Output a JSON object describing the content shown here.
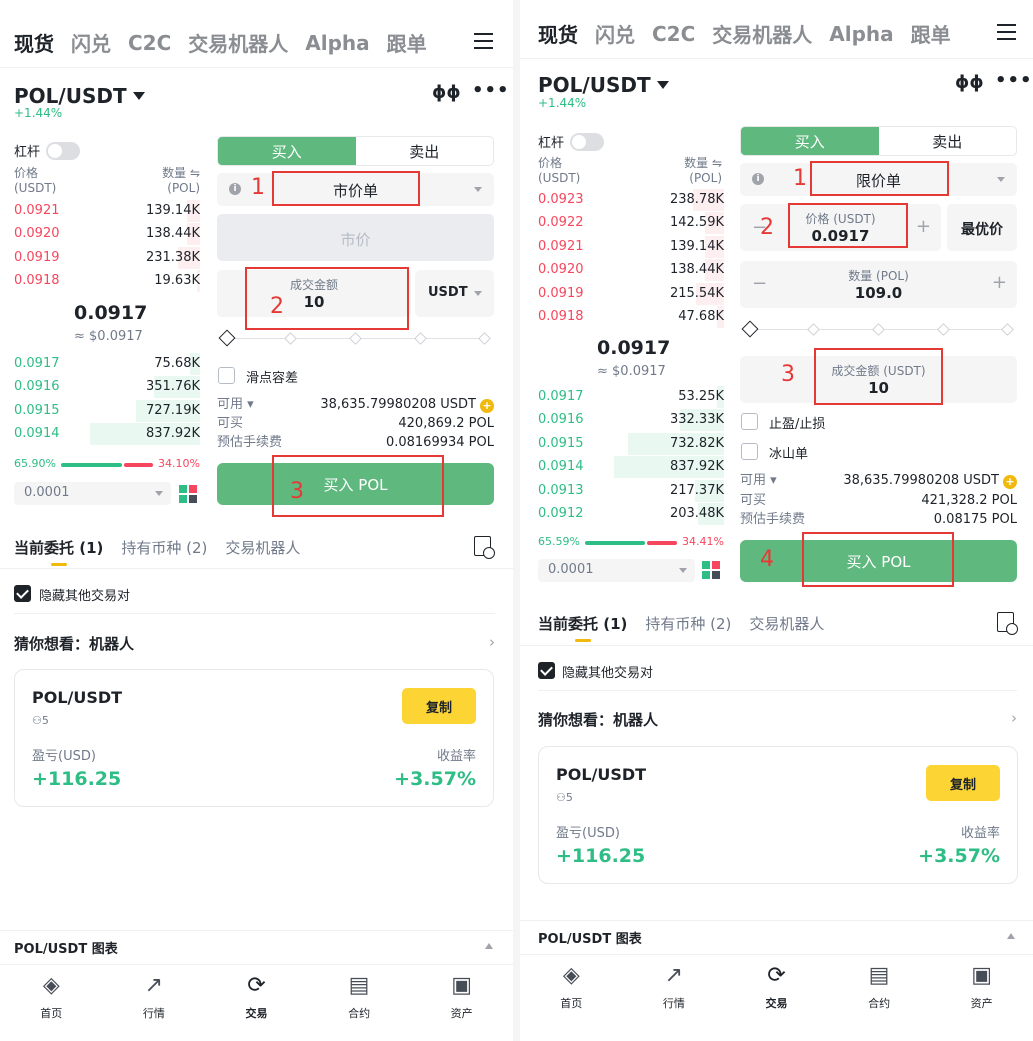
{
  "top_tabs": [
    "现货",
    "闪兑",
    "C2C",
    "交易机器人",
    "Alpha",
    "跟单"
  ],
  "pair": "POL/USDT",
  "change": "+1.44%",
  "leverage_label": "杠杆",
  "price_header": "价格",
  "price_unit": "(USDT)",
  "qty_header": "数量 ⇋",
  "qty_unit": "(POL)",
  "buy_label": "买入",
  "sell_label": "卖出",
  "left": {
    "asks": [
      {
        "price": "0.0921",
        "qty": "139.14K",
        "depth": 0.12
      },
      {
        "price": "0.0920",
        "qty": "138.44K",
        "depth": 0.12
      },
      {
        "price": "0.0919",
        "qty": "231.38K",
        "depth": 0.2
      },
      {
        "price": "0.0918",
        "qty": "19.63K",
        "depth": 0.03
      }
    ],
    "mid_price": "0.0917",
    "mid_usd": "≈ $0.0917",
    "bids": [
      {
        "price": "0.0917",
        "qty": "75.68K",
        "depth": 0.09
      },
      {
        "price": "0.0916",
        "qty": "351.76K",
        "depth": 0.42
      },
      {
        "price": "0.0915",
        "qty": "727.19K",
        "depth": 0.58
      },
      {
        "price": "0.0914",
        "qty": "837.92K",
        "depth": 1.0
      }
    ],
    "ratio_buy": "65.90%",
    "ratio_sell": "34.10%",
    "ratio_buy_fraction": 0.659,
    "step": "0.0001",
    "order_type": "市价单",
    "market_price_label": "市价",
    "amount_label": "成交金额",
    "amount_value": "10",
    "amount_unit": "USDT",
    "slippage_label": "滑点容差",
    "available_label": "可用",
    "available_value": "38,635.79980208 USDT",
    "can_buy_label": "可买",
    "can_buy_value": "420,869.2 POL",
    "fee_label": "预估手续费",
    "fee_value": "0.08169934 POL",
    "buy_button": "买入 POL",
    "markers": [
      "1",
      "2",
      "3"
    ]
  },
  "right": {
    "asks": [
      {
        "price": "0.0923",
        "qty": "238.78K",
        "depth": 0.28
      },
      {
        "price": "0.0922",
        "qty": "142.59K",
        "depth": 0.17
      },
      {
        "price": "0.0921",
        "qty": "139.14K",
        "depth": 0.17
      },
      {
        "price": "0.0920",
        "qty": "138.44K",
        "depth": 0.17
      },
      {
        "price": "0.0919",
        "qty": "215.54K",
        "depth": 0.25
      },
      {
        "price": "0.0918",
        "qty": "47.68K",
        "depth": 0.06
      }
    ],
    "mid_price": "0.0917",
    "mid_usd": "≈ $0.0917",
    "bids": [
      {
        "price": "0.0917",
        "qty": "53.25K",
        "depth": 0.06
      },
      {
        "price": "0.0916",
        "qty": "332.33K",
        "depth": 0.4
      },
      {
        "price": "0.0915",
        "qty": "732.82K",
        "depth": 0.87
      },
      {
        "price": "0.0914",
        "qty": "837.92K",
        "depth": 1.0
      },
      {
        "price": "0.0913",
        "qty": "217.37K",
        "depth": 0.26
      },
      {
        "price": "0.0912",
        "qty": "203.48K",
        "depth": 0.24
      }
    ],
    "ratio_buy": "65.59%",
    "ratio_sell": "34.41%",
    "ratio_buy_fraction": 0.6559,
    "step": "0.0001",
    "order_type": "限价单",
    "price_label": "价格 (USDT)",
    "price_value": "0.0917",
    "best_price": "最优价",
    "qty_label": "数量 (POL)",
    "qty_value": "109.0",
    "amount_label": "成交金额 (USDT)",
    "amount_value": "10",
    "tpsl_label": "止盈/止损",
    "iceberg_label": "冰山单",
    "available_label": "可用",
    "available_value": "38,635.79980208 USDT",
    "can_buy_label": "可买",
    "can_buy_value": "421,328.2 POL",
    "fee_label": "预估手续费",
    "fee_value": "0.08175 POL",
    "buy_button": "买入 POL",
    "markers": [
      "1",
      "2",
      "3",
      "4"
    ]
  },
  "order_tabs": [
    "当前委托 (1)",
    "持有币种 (2)",
    "交易机器人"
  ],
  "hide_pairs": "隐藏其他交易对",
  "guess": "猜你想看：机器人",
  "card": {
    "title": "POL/USDT",
    "users": "5",
    "copy": "复制",
    "pnl_label": "盈亏(USD)",
    "pnl_value": "+116.25",
    "roi_label": "收益率",
    "roi_value": "+3.57%"
  },
  "chart_bar": "POL/USDT 图表",
  "nav": [
    {
      "label": "首页",
      "icon": "home-icon"
    },
    {
      "label": "行情",
      "icon": "markets-icon"
    },
    {
      "label": "交易",
      "icon": "trade-icon"
    },
    {
      "label": "合约",
      "icon": "futures-icon"
    },
    {
      "label": "资产",
      "icon": "wallet-icon"
    }
  ],
  "colors": {
    "buy": "#5fb97f",
    "ask": "#f6465d",
    "bid": "#2ebd85",
    "copy": "#fcd535",
    "annotation": "#e53935"
  }
}
